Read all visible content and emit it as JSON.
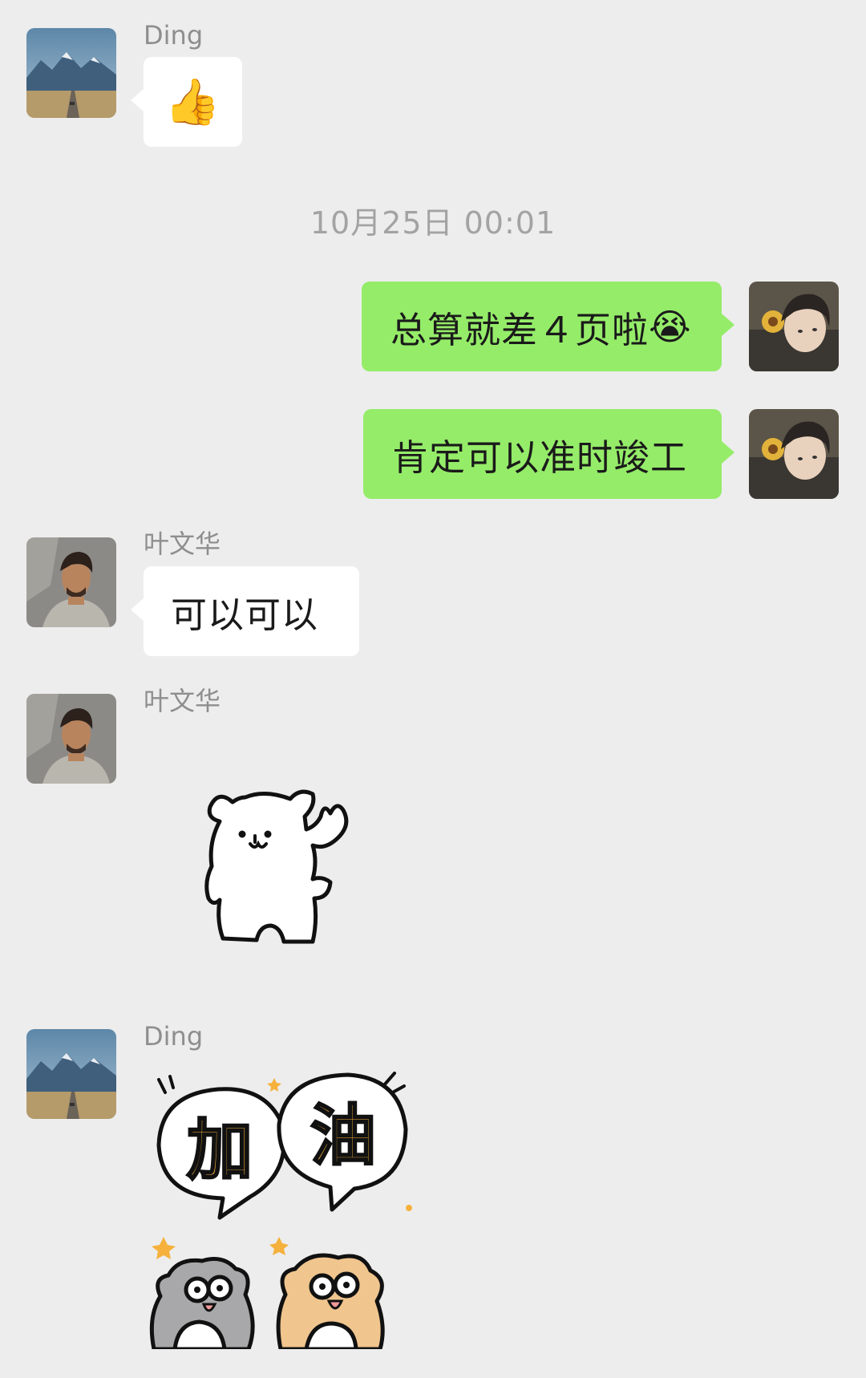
{
  "messages": [
    {
      "sender": "Ding",
      "type": "emoji",
      "emoji": "👍",
      "direction": "incoming"
    },
    {
      "type": "timestamp",
      "text": "10月25日 00:01"
    },
    {
      "direction": "outgoing",
      "type": "text",
      "text": "总算就差４页啦",
      "emoji": "😭"
    },
    {
      "direction": "outgoing",
      "type": "text",
      "text": "肯定可以准时竣工"
    },
    {
      "sender": "叶文华",
      "type": "text",
      "text": "可以可以",
      "direction": "incoming"
    },
    {
      "sender": "叶文华",
      "type": "sticker",
      "sticker": "white-bear-waving-sticker",
      "direction": "incoming"
    },
    {
      "sender": "Ding",
      "type": "sticker",
      "sticker": "jiayou-cats-sticker",
      "sticker_text": "加油",
      "direction": "incoming"
    }
  ],
  "colors": {
    "background": "#ededed",
    "incoming_bubble": "#ffffff",
    "outgoing_bubble": "#95ec69",
    "name_text": "#8e8e8e",
    "timestamp_text": "#a3a3a3",
    "sticker_yellow": "#f5b13c"
  },
  "icons": {
    "avatar_ding": "mountain-road-avatar",
    "avatar_self": "boy-with-sunflower-avatar",
    "avatar_ye": "man-portrait-avatar"
  }
}
